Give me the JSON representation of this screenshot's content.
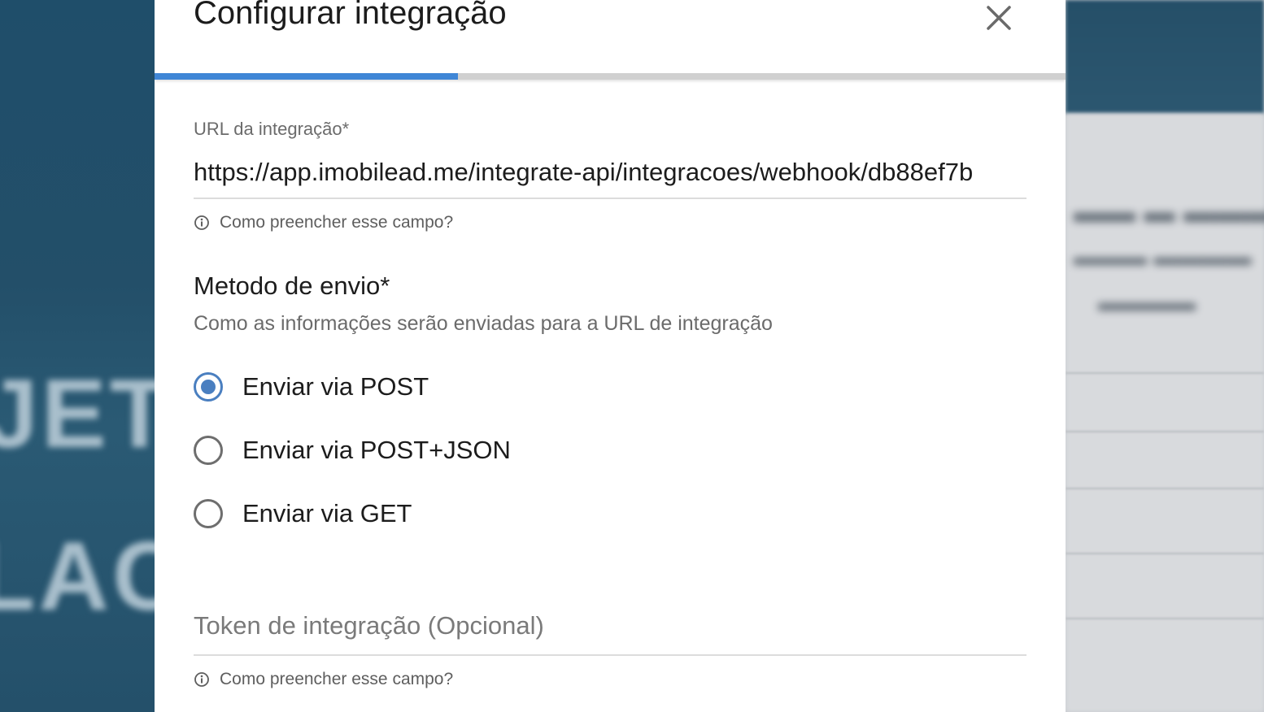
{
  "dialog": {
    "title": "Configurar integração",
    "progress_fraction": 0.333
  },
  "url_field": {
    "label": "URL da integração*",
    "value": "https://app.imobilead.me/integrate-api/integracoes/webhook/db88ef7b",
    "helper": "Como preencher esse campo?"
  },
  "method": {
    "title": "Metodo de envio*",
    "description": "Como as informações serão enviadas para a URL de integração",
    "options": [
      {
        "label": "Enviar via POST",
        "selected": true
      },
      {
        "label": "Enviar via POST+JSON",
        "selected": false
      },
      {
        "label": "Enviar via GET",
        "selected": false
      }
    ]
  },
  "token_field": {
    "placeholder": "Token de integração (Opcional)",
    "helper": "Como preencher esse campo?"
  },
  "colors": {
    "accent": "#3f86d6",
    "radio_selected": "#4a7fc0",
    "background_blue": "#234f69"
  }
}
